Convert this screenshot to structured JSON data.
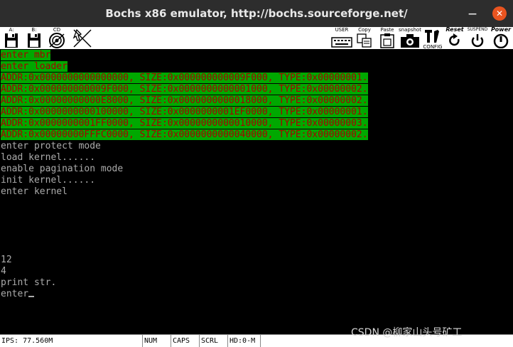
{
  "window": {
    "title": "Bochs x86 emulator, http://bochs.sourceforge.net/",
    "minimize_glyph": "—",
    "close_glyph": "✕"
  },
  "toolbar": {
    "floppy_a": {
      "label": "A:",
      "icon": "floppy-icon"
    },
    "floppy_b": {
      "label": "B:",
      "icon": "floppy-icon"
    },
    "cdrom": {
      "label": "CD",
      "icon": "cdrom-icon"
    },
    "mouse": {
      "label": "",
      "icon": "mouse-disabled-icon"
    },
    "user": {
      "label": "USER",
      "icon": "keyboard-icon"
    },
    "copy": {
      "label": "Copy",
      "icon": "copy-icon"
    },
    "paste": {
      "label": "Paste",
      "icon": "paste-icon"
    },
    "snapshot": {
      "label": "snapshot",
      "icon": "camera-icon"
    },
    "config": {
      "label": "CONFIG",
      "icon": "config-icon"
    },
    "reset": {
      "label": "Reset",
      "icon": "reset-icon"
    },
    "suspend": {
      "label": "SUSPEND",
      "icon": "suspend-icon"
    },
    "power": {
      "label": "Power",
      "icon": "power-icon"
    }
  },
  "terminal": {
    "lines": [
      {
        "text": "enter mbr",
        "highlight": true
      },
      {
        "text": "enter loader",
        "highlight": true
      },
      {
        "text": "ADDR:0x0000000000000000, SIZE:0x000000000009F000, TYPE:0x00000001.",
        "highlight": true
      },
      {
        "text": "ADDR:0x000000000009F000, SIZE:0x0000000000001000, TYPE:0x00000002.",
        "highlight": true
      },
      {
        "text": "ADDR:0x00000000000E8000, SIZE:0x0000000000018000, TYPE:0x00000002.",
        "highlight": true
      },
      {
        "text": "ADDR:0x0000000000100000, SIZE:0x0000000001EF0000, TYPE:0x00000001.",
        "highlight": true
      },
      {
        "text": "ADDR:0x0000000001FF0000, SIZE:0x0000000000010000, TYPE:0x00000003.",
        "highlight": true
      },
      {
        "text": "ADDR:0x00000000FFFC0000, SIZE:0x0000000000040000, TYPE:0x00000002.",
        "highlight": true
      },
      {
        "text": "enter protect mode",
        "highlight": false
      },
      {
        "text": "load kernel......",
        "highlight": false
      },
      {
        "text": "enable pagination mode",
        "highlight": false
      },
      {
        "text": "init kernel......",
        "highlight": false
      },
      {
        "text": "enter kernel",
        "highlight": false
      },
      {
        "text": "",
        "highlight": false
      },
      {
        "text": "",
        "highlight": false
      },
      {
        "text": "",
        "highlight": false
      },
      {
        "text": "",
        "highlight": false
      },
      {
        "text": "",
        "highlight": false
      },
      {
        "text": "12",
        "highlight": false
      },
      {
        "text": "4",
        "highlight": false
      },
      {
        "text": "print str.",
        "highlight": false
      },
      {
        "text": "enter",
        "highlight": false,
        "cursor": true
      }
    ],
    "colors": {
      "background": "#000000",
      "foreground": "#ababab",
      "highlight_bg": "#00a800",
      "highlight_fg": "#a80000"
    }
  },
  "statusbar": {
    "ips": "IPS: 77.560M",
    "num": "NUM",
    "caps": "CAPS",
    "scrl": "SCRL",
    "hd": "HD:0-M"
  },
  "watermark": "CSDN @柳家山头号矿工"
}
